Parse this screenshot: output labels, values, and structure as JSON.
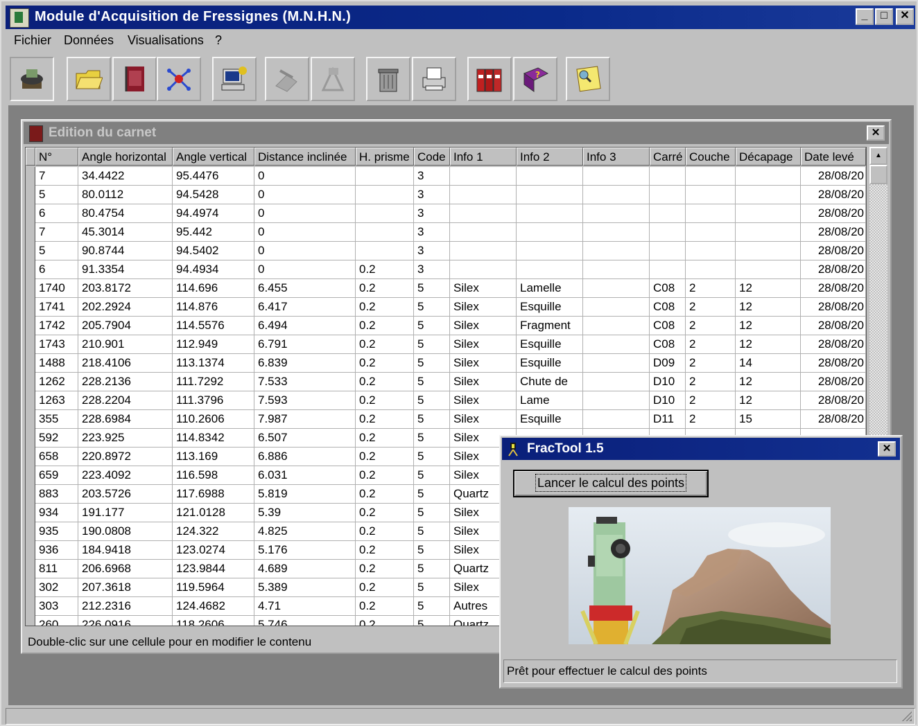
{
  "app": {
    "title": "Module d'Acquisition de Fressignes (M.N.H.N.)",
    "window_buttons": {
      "minimize": "_",
      "maximize": "□",
      "close": "✕"
    }
  },
  "menu": [
    {
      "label": "Fichier"
    },
    {
      "label": "Données"
    },
    {
      "label": "Visualisations"
    },
    {
      "label": "?"
    }
  ],
  "toolbar": [
    {
      "icon": "total-station-icon",
      "pressed": true
    },
    {
      "icon": "open-folder-icon"
    },
    {
      "icon": "notebook-icon"
    },
    {
      "icon": "network-points-icon"
    },
    {
      "icon": "computer-settings-icon"
    },
    {
      "icon": "disabled-tool-icon"
    },
    {
      "icon": "disabled-photo-icon"
    },
    {
      "icon": "trash-icon"
    },
    {
      "icon": "printer-icon"
    },
    {
      "icon": "binders-icon"
    },
    {
      "icon": "help-book-icon"
    },
    {
      "icon": "search-note-icon"
    }
  ],
  "carnet": {
    "title": "Edition du carnet",
    "close": "✕",
    "status": "Double-clic sur une cellule pour en modifier le contenu",
    "columns": [
      "N°",
      "Angle horizontal",
      "Angle vertical",
      "Distance inclinée",
      "H. prisme",
      "Code",
      "Info 1",
      "Info 2",
      "Info 3",
      "Carré",
      "Couche",
      "Décapage",
      "Date levé"
    ],
    "rows": [
      [
        "7",
        "34.4422",
        "95.4476",
        "0",
        "",
        "3",
        "",
        "",
        "",
        "",
        "",
        "",
        "28/08/20"
      ],
      [
        "5",
        "80.0112",
        "94.5428",
        "0",
        "",
        "3",
        "",
        "",
        "",
        "",
        "",
        "",
        "28/08/20"
      ],
      [
        "6",
        "80.4754",
        "94.4974",
        "0",
        "",
        "3",
        "",
        "",
        "",
        "",
        "",
        "",
        "28/08/20"
      ],
      [
        "7",
        "45.3014",
        "95.442",
        "0",
        "",
        "3",
        "",
        "",
        "",
        "",
        "",
        "",
        "28/08/20"
      ],
      [
        "5",
        "90.8744",
        "94.5402",
        "0",
        "",
        "3",
        "",
        "",
        "",
        "",
        "",
        "",
        "28/08/20"
      ],
      [
        "6",
        "91.3354",
        "94.4934",
        "0",
        "0.2",
        "3",
        "",
        "",
        "",
        "",
        "",
        "",
        "28/08/20"
      ],
      [
        "1740",
        "203.8172",
        "114.696",
        "6.455",
        "0.2",
        "5",
        "Silex",
        "Lamelle",
        "",
        "C08",
        "2",
        "12",
        "28/08/20"
      ],
      [
        "1741",
        "202.2924",
        "114.876",
        "6.417",
        "0.2",
        "5",
        "Silex",
        "Esquille",
        "",
        "C08",
        "2",
        "12",
        "28/08/20"
      ],
      [
        "1742",
        "205.7904",
        "114.5576",
        "6.494",
        "0.2",
        "5",
        "Silex",
        "Fragment",
        "",
        "C08",
        "2",
        "12",
        "28/08/20"
      ],
      [
        "1743",
        "210.901",
        "112.949",
        "6.791",
        "0.2",
        "5",
        "Silex",
        "Esquille",
        "",
        "C08",
        "2",
        "12",
        "28/08/20"
      ],
      [
        "1488",
        "218.4106",
        "113.1374",
        "6.839",
        "0.2",
        "5",
        "Silex",
        "Esquille",
        "",
        "D09",
        "2",
        "14",
        "28/08/20"
      ],
      [
        "1262",
        "228.2136",
        "111.7292",
        "7.533",
        "0.2",
        "5",
        "Silex",
        "Chute de",
        "",
        "D10",
        "2",
        "12",
        "28/08/20"
      ],
      [
        "1263",
        "228.2204",
        "111.3796",
        "7.593",
        "0.2",
        "5",
        "Silex",
        "Lame",
        "",
        "D10",
        "2",
        "12",
        "28/08/20"
      ],
      [
        "355",
        "228.6984",
        "110.2606",
        "7.987",
        "0.2",
        "5",
        "Silex",
        "Esquille",
        "",
        "D11",
        "2",
        "15",
        "28/08/20"
      ],
      [
        "592",
        "223.925",
        "114.8342",
        "6.507",
        "0.2",
        "5",
        "Silex",
        "",
        "",
        "",
        "",
        "",
        ""
      ],
      [
        "658",
        "220.8972",
        "113.169",
        "6.886",
        "0.2",
        "5",
        "Silex",
        "",
        "",
        "",
        "",
        "",
        ""
      ],
      [
        "659",
        "223.4092",
        "116.598",
        "6.031",
        "0.2",
        "5",
        "Silex",
        "",
        "",
        "",
        "",
        "",
        ""
      ],
      [
        "883",
        "203.5726",
        "117.6988",
        "5.819",
        "0.2",
        "5",
        "Quartz",
        "",
        "",
        "",
        "",
        "",
        ""
      ],
      [
        "934",
        "191.177",
        "121.0128",
        "5.39",
        "0.2",
        "5",
        "Silex",
        "",
        "",
        "",
        "",
        "",
        ""
      ],
      [
        "935",
        "190.0808",
        "124.322",
        "4.825",
        "0.2",
        "5",
        "Silex",
        "",
        "",
        "",
        "",
        "",
        ""
      ],
      [
        "936",
        "184.9418",
        "123.0274",
        "5.176",
        "0.2",
        "5",
        "Silex",
        "",
        "",
        "",
        "",
        "",
        ""
      ],
      [
        "811",
        "206.6968",
        "123.9844",
        "4.689",
        "0.2",
        "5",
        "Quartz",
        "",
        "",
        "",
        "",
        "",
        ""
      ],
      [
        "302",
        "207.3618",
        "119.5964",
        "5.389",
        "0.2",
        "5",
        "Silex",
        "",
        "",
        "",
        "",
        "",
        ""
      ],
      [
        "303",
        "212.2316",
        "124.4682",
        "4.71",
        "0.2",
        "5",
        "Autres",
        "",
        "",
        "",
        "",
        "",
        ""
      ],
      [
        "260",
        "226.0916",
        "118.2606",
        "5.746",
        "0.2",
        "5",
        "Quartz",
        "",
        "",
        "",
        "",
        "",
        ""
      ]
    ]
  },
  "fractool": {
    "title": "FracTool 1.5",
    "close": "✕",
    "run_button": "Lancer le calcul des points",
    "status": "Prêt pour effectuer le calcul des points"
  },
  "colors": {
    "titlebar": "#0a1f7a",
    "face": "#c0c0c0",
    "workspace": "#808080",
    "inactive_title": "#808080"
  }
}
